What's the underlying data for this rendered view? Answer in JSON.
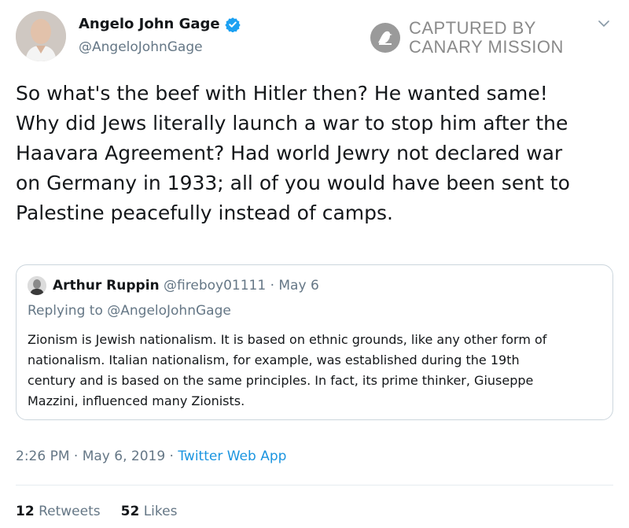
{
  "author": {
    "name": "Angelo John Gage",
    "handle": "@AngeloJohnGage",
    "verified": true
  },
  "watermark": {
    "line1": "CAPTURED BY",
    "line2": "CANARY MISSION"
  },
  "tweet": {
    "lines": [
      "So what's the beef with Hitler then? He wanted same!",
      "Why did Jews literally launch a war to stop him after the",
      "Haavara Agreement? Had world Jewry not declared war",
      "on Germany in 1933; all of you would have been sent to",
      "Palestine peacefully instead of camps."
    ]
  },
  "quoted_tweet": {
    "name": "Arthur Ruppin",
    "handle": "@fireboy01111",
    "separator": " · ",
    "date": "May 6",
    "replying_to": "Replying to @AngeloJohnGage",
    "lines": [
      "Zionism is Jewish nationalism. It is based on ethnic grounds, like any other form of",
      "nationalism. Italian nationalism, for example, was established during the 19th",
      "century and is based on the same principles. In fact, its prime thinker, Giuseppe",
      "Mazzini, influenced many Zionists."
    ]
  },
  "meta": {
    "timestamp": "2:26 PM · May 6, 2019 · ",
    "source": "Twitter Web App"
  },
  "stats": {
    "retweets_count": "12",
    "retweets_label": "Retweets",
    "likes_count": "52",
    "likes_label": "Likes"
  },
  "colors": {
    "text": "#14171a",
    "secondary": "#657786",
    "link": "#1b95e0",
    "verified": "#1da1f2",
    "border": "#ccd6dd",
    "watermark": "#8a8a8a"
  },
  "icons": {
    "verified": "verified-badge-icon",
    "caret": "chevron-down-icon",
    "watermark_logo": "canary-bird-icon"
  }
}
